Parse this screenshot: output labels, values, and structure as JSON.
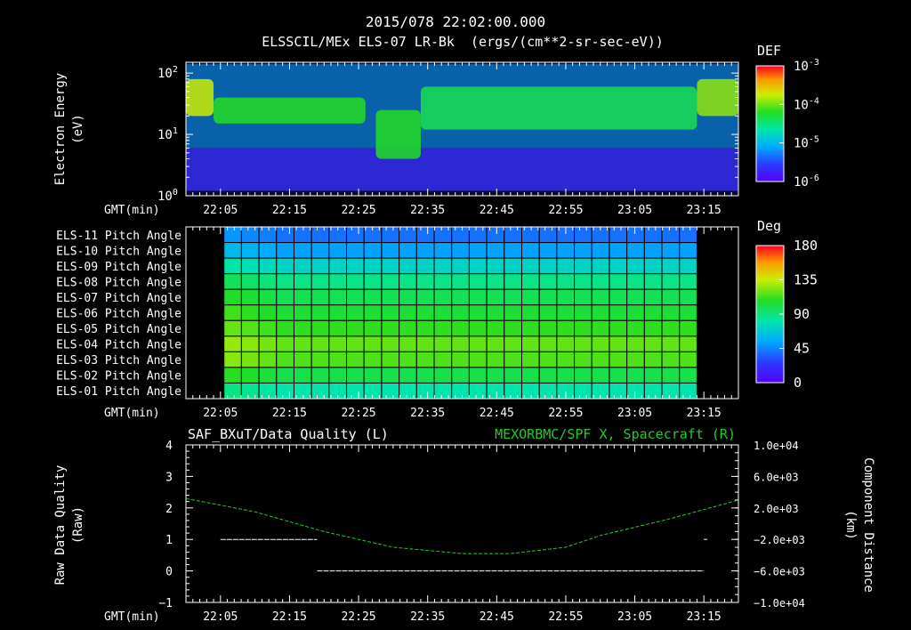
{
  "header": {
    "datetime": "2015/078 22:02:00.000",
    "subtitle": "ELSSCIL/MEx ELS-07 LR-Bk  (ergs/(cm**2-sr-sec-eV))"
  },
  "colors": {
    "background": "#000000",
    "foreground": "#ffffff",
    "spacecraft_series": "#22cc22"
  },
  "chart_data": [
    {
      "type": "heatmap",
      "name": "energy-spectrogram",
      "ylabel": "Electron Energy",
      "yunit": "(eV)",
      "xlabel": "GMT(min)",
      "x_tick_labels": [
        "22:05",
        "22:15",
        "22:25",
        "22:35",
        "22:45",
        "22:55",
        "23:05",
        "23:15"
      ],
      "x_ticks_min": [
        5,
        15,
        25,
        35,
        45,
        55,
        65,
        75
      ],
      "xlim_min": [
        0,
        80
      ],
      "y_scale": "log",
      "ylim": [
        1,
        150
      ],
      "y_tick_values": [
        1,
        10,
        100
      ],
      "y_tick_labels": [
        {
          "base": "10",
          "exp": "0"
        },
        {
          "base": "10",
          "exp": "1"
        },
        {
          "base": "10",
          "exp": "2"
        }
      ],
      "colorbar": {
        "title": "DEF",
        "scale": "log",
        "range": [
          1e-06,
          0.001
        ],
        "tick_values": [
          0.001,
          0.0001,
          1e-05,
          1e-06
        ],
        "tick_labels": [
          {
            "base": "10",
            "exp": "-3"
          },
          {
            "base": "10",
            "exp": "-4"
          },
          {
            "base": "10",
            "exp": "-5"
          },
          {
            "base": "10",
            "exp": "-6"
          }
        ]
      },
      "features": [
        {
          "t_start": 0,
          "t_end": 4,
          "e_low": 20,
          "e_high": 80,
          "level": 0.75
        },
        {
          "t_start": 4,
          "t_end": 26,
          "e_low": 15,
          "e_high": 40,
          "level": 0.6
        },
        {
          "t_start": 27.5,
          "t_end": 34,
          "e_low": 4,
          "e_high": 25,
          "level": 0.6
        },
        {
          "t_start": 34,
          "t_end": 74,
          "e_low": 12,
          "e_high": 60,
          "level": 0.55
        },
        {
          "t_start": 74,
          "t_end": 80,
          "e_low": 20,
          "e_high": 80,
          "level": 0.7
        }
      ]
    },
    {
      "type": "heatmap",
      "name": "pitch-angle-grid",
      "xlabel": "GMT(min)",
      "x_tick_labels": [
        "22:05",
        "22:15",
        "22:25",
        "22:35",
        "22:45",
        "22:55",
        "23:05",
        "23:15"
      ],
      "x_ticks_min": [
        5,
        15,
        25,
        35,
        45,
        55,
        65,
        75
      ],
      "xlim_min": [
        0,
        80
      ],
      "data_range_min": [
        5.5,
        74
      ],
      "rows": [
        "ELS-11 Pitch Angle",
        "ELS-10 Pitch Angle",
        "ELS-09 Pitch Angle",
        "ELS-08 Pitch Angle",
        "ELS-07 Pitch Angle",
        "ELS-06 Pitch Angle",
        "ELS-05 Pitch Angle",
        "ELS-04 Pitch Angle",
        "ELS-03 Pitch Angle",
        "ELS-02 Pitch Angle",
        "ELS-01 Pitch Angle"
      ],
      "row_values_deg": [
        40,
        52,
        72,
        88,
        98,
        104,
        110,
        118,
        115,
        100,
        80
      ],
      "colorbar": {
        "title": "Deg",
        "range": [
          0,
          180
        ],
        "tick_values": [
          180,
          135,
          90,
          45,
          0
        ],
        "tick_labels": [
          "180",
          "135",
          "90",
          "45",
          "0"
        ]
      }
    },
    {
      "type": "line",
      "name": "data-quality-and-position",
      "title_left": "SAF_BXuT/Data Quality (L)",
      "title_right": "MEXORBMC/SPF X, Spacecraft (R)",
      "xlabel": "GMT(min)",
      "x_tick_labels": [
        "22:05",
        "22:15",
        "22:25",
        "22:35",
        "22:45",
        "22:55",
        "23:05",
        "23:15"
      ],
      "x_ticks_min": [
        5,
        15,
        25,
        35,
        45,
        55,
        65,
        75
      ],
      "xlim_min": [
        0,
        80
      ],
      "ylabel_left": "Raw Data Quality",
      "yunit_left": "(Raw)",
      "ylim_left": [
        -1,
        4
      ],
      "y_ticks_left": [
        "4",
        "3",
        "2",
        "1",
        "0",
        "−1"
      ],
      "ylabel_right": "Component Distance",
      "yunit_right": "(km)",
      "ylim_right": [
        -10000,
        10000
      ],
      "y_ticks_right_values": [
        10000,
        6000,
        2000,
        -2000,
        -6000,
        -10000
      ],
      "y_ticks_right": [
        "1.0e+04",
        "6.0e+03",
        "2.0e+03",
        "−2.0e+03",
        "−6.0e+03",
        "−1.0e+04"
      ],
      "series": [
        {
          "axis": "left",
          "segments": [
            {
              "x": [
                5,
                19
              ],
              "y": [
                1,
                1
              ]
            },
            {
              "x": [
                19,
                75
              ],
              "y": [
                0,
                0
              ]
            },
            {
              "x": [
                75,
                75.5
              ],
              "y": [
                1,
                1
              ]
            }
          ]
        },
        {
          "axis": "right",
          "x": [
            0,
            10,
            20,
            30,
            40,
            47,
            55,
            60,
            70,
            80
          ],
          "y": [
            3200,
            1500,
            -1000,
            -3000,
            -3800,
            -3800,
            -3000,
            -1500,
            600,
            3000
          ]
        }
      ]
    }
  ]
}
